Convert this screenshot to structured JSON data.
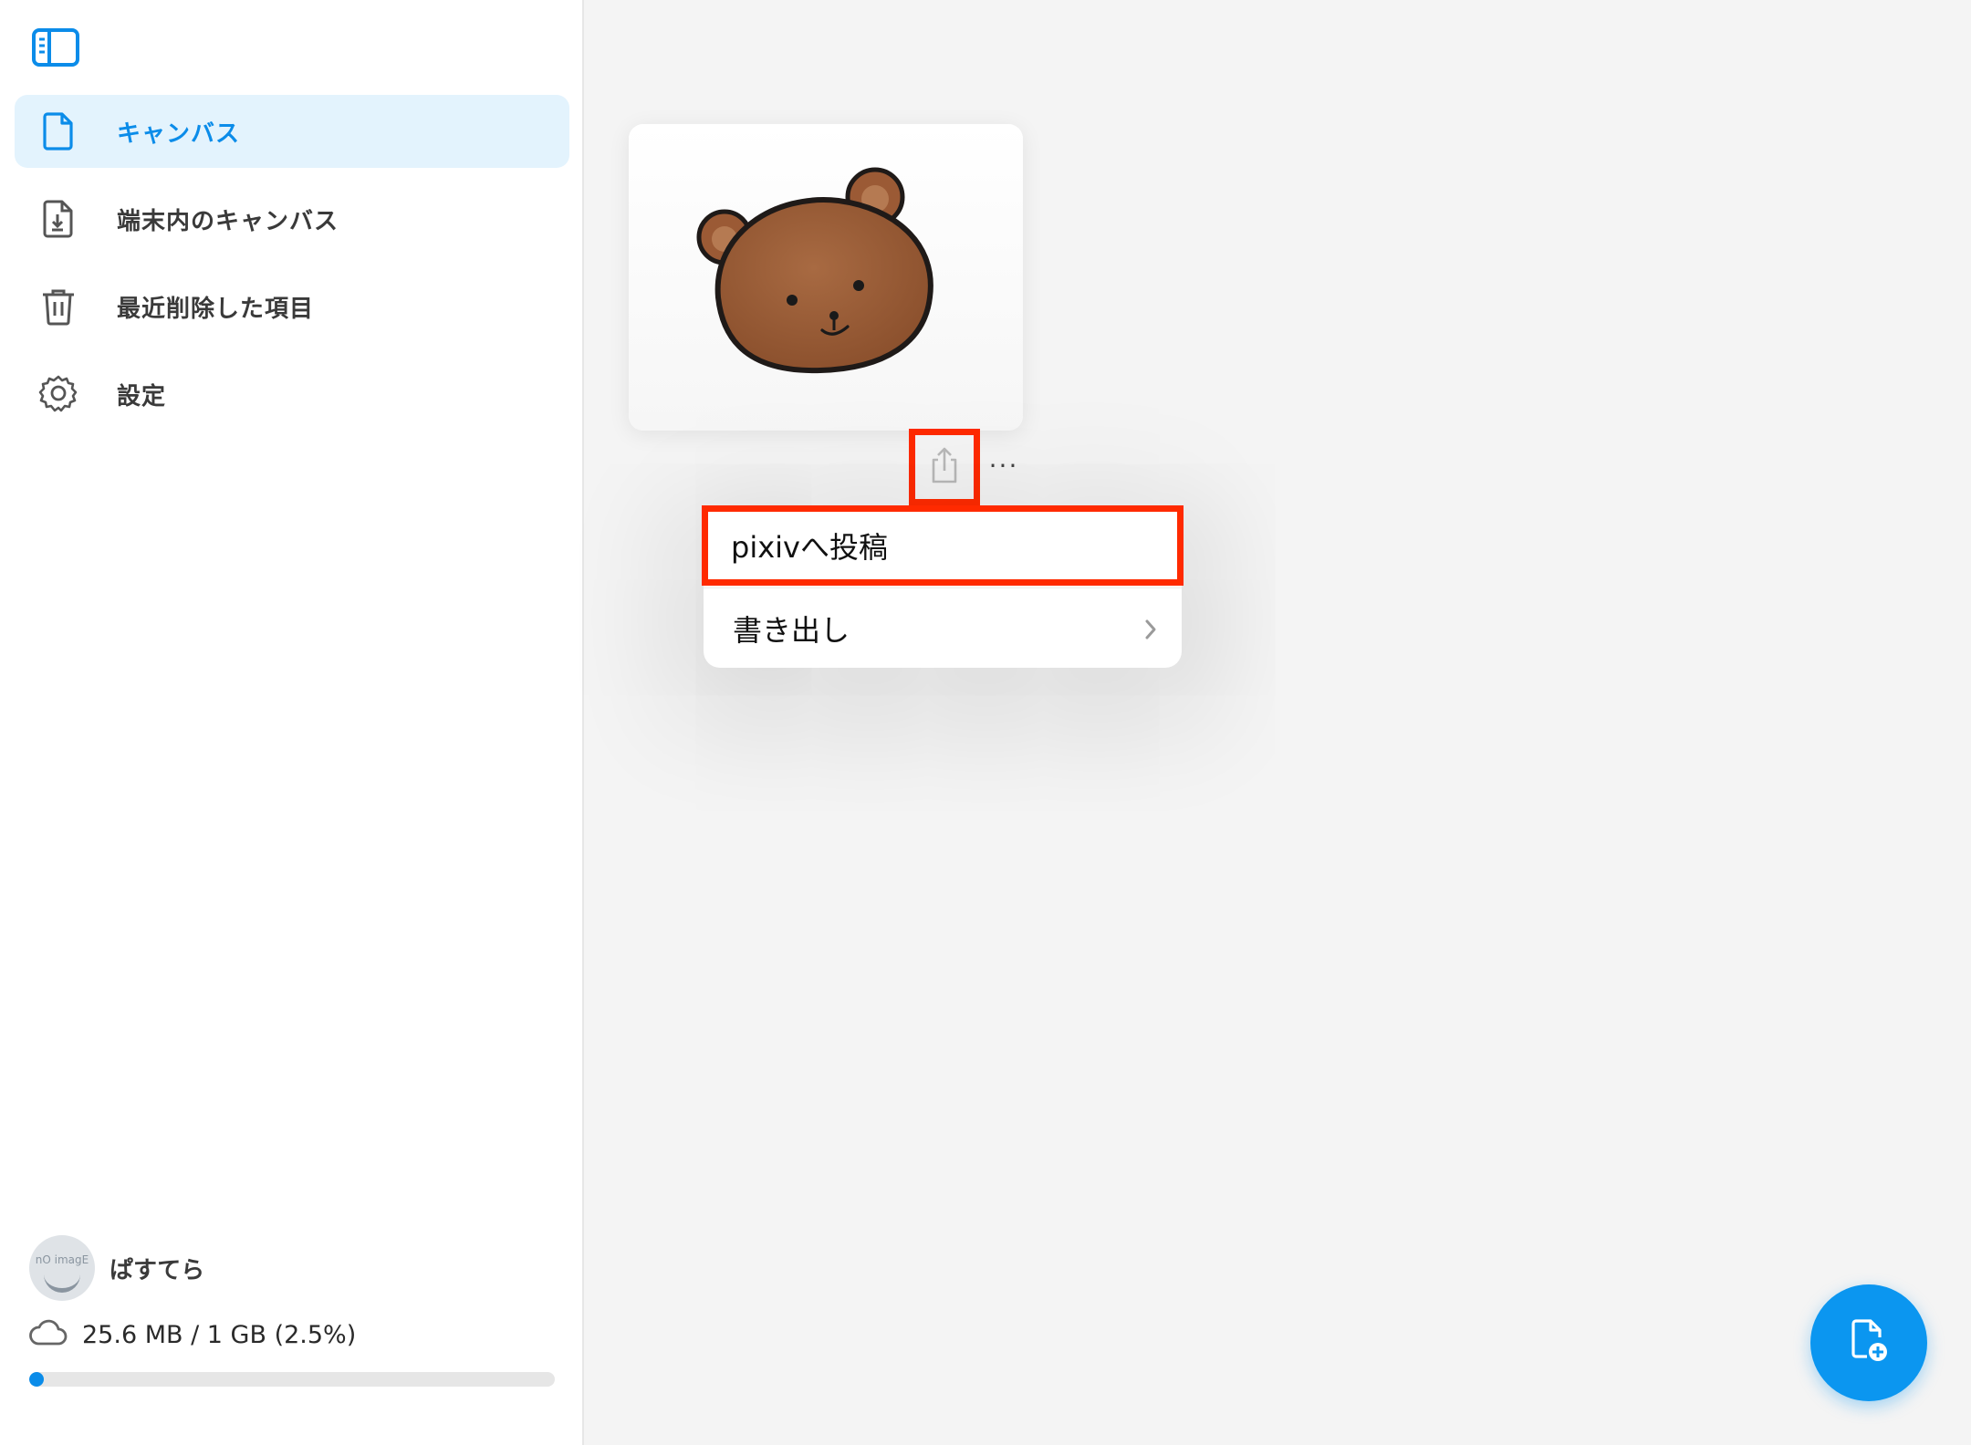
{
  "sidebar": {
    "items": [
      {
        "label": "キャンバス",
        "icon": "document-icon",
        "active": true
      },
      {
        "label": "端末内のキャンバス",
        "icon": "document-download-icon",
        "active": false
      },
      {
        "label": "最近削除した項目",
        "icon": "trash-icon",
        "active": false
      },
      {
        "label": "設定",
        "icon": "gear-icon",
        "active": false
      }
    ],
    "user": {
      "name": "ぱすてら",
      "avatar_text": "nO imagE"
    },
    "storage": {
      "text": "25.6 MB / 1 GB (2.5%)",
      "fraction": 0.025
    }
  },
  "card": {
    "more_label": "···"
  },
  "menu": {
    "items": [
      {
        "label": "pixivへ投稿",
        "highlighted": true
      },
      {
        "label": "書き出し",
        "has_submenu": true
      }
    ]
  },
  "colors": {
    "accent": "#0b8ce9",
    "highlight": "#ff2a00",
    "fab": "#0b96f0"
  }
}
